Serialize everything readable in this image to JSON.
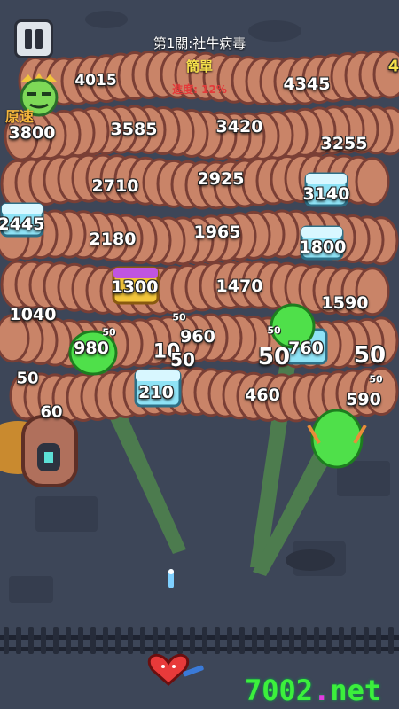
{
  "level_title": "第1關:社牛病毒",
  "difficulty": "簡單",
  "progress_text": "進度: 12%",
  "speed_label": "原速",
  "pause_label": "pause",
  "hp_values": [
    {
      "id": "hp-4015",
      "text": "4015"
    },
    {
      "id": "hp-4345",
      "text": "4345"
    },
    {
      "id": "hp-3800",
      "text": "3800"
    },
    {
      "id": "hp-3585",
      "text": "3585"
    },
    {
      "id": "hp-3420",
      "text": "3420"
    },
    {
      "id": "hp-3255",
      "text": "3255"
    },
    {
      "id": "hp-2710",
      "text": "2710"
    },
    {
      "id": "hp-2925",
      "text": "2925"
    },
    {
      "id": "hp-3140",
      "text": "3140"
    },
    {
      "id": "hp-2445",
      "text": "2445"
    },
    {
      "id": "hp-2180",
      "text": "2180"
    },
    {
      "id": "hp-1965",
      "text": "1965"
    },
    {
      "id": "hp-1800",
      "text": "1800"
    },
    {
      "id": "hp-1300",
      "text": "1300"
    },
    {
      "id": "hp-1470",
      "text": "1470"
    },
    {
      "id": "hp-1590",
      "text": "1590"
    },
    {
      "id": "hp-1040",
      "text": "1040"
    },
    {
      "id": "hp-980",
      "text": "980"
    },
    {
      "id": "hp-10",
      "text": "10"
    },
    {
      "id": "hp-960",
      "text": "960"
    },
    {
      "id": "hp-760",
      "text": "760"
    },
    {
      "id": "hp-50a",
      "text": "50"
    },
    {
      "id": "hp-50b",
      "text": "50"
    },
    {
      "id": "hp-50c",
      "text": "50"
    },
    {
      "id": "hp-50d",
      "text": "50"
    },
    {
      "id": "hp-210",
      "text": "210"
    },
    {
      "id": "hp-460",
      "text": "460"
    },
    {
      "id": "hp-590",
      "text": "590"
    },
    {
      "id": "hp-60",
      "text": "60"
    },
    {
      "id": "hp-4",
      "text": "4"
    }
  ],
  "damage_values": [
    "50",
    "50",
    "50",
    "50",
    "50"
  ],
  "watermark_main": "7002",
  "watermark_dot": ".",
  "watermark_tail": "net",
  "colors": {
    "background": "#3d4658",
    "snake_body": "#c98468",
    "snake_dark": "#7a3f35",
    "virus_green": "#4fe04a",
    "chest_blue": "#8fe3f6",
    "chest_gold": "#f2c53a",
    "progress_red": "#e43a3a",
    "difficulty_yellow": "#f6e04b"
  },
  "icons": [
    "pause-icon",
    "speed-virus-icon",
    "virus-turret-icon",
    "chest-icon",
    "heart-player-icon",
    "bullet-icon",
    "spawn-house-icon"
  ]
}
